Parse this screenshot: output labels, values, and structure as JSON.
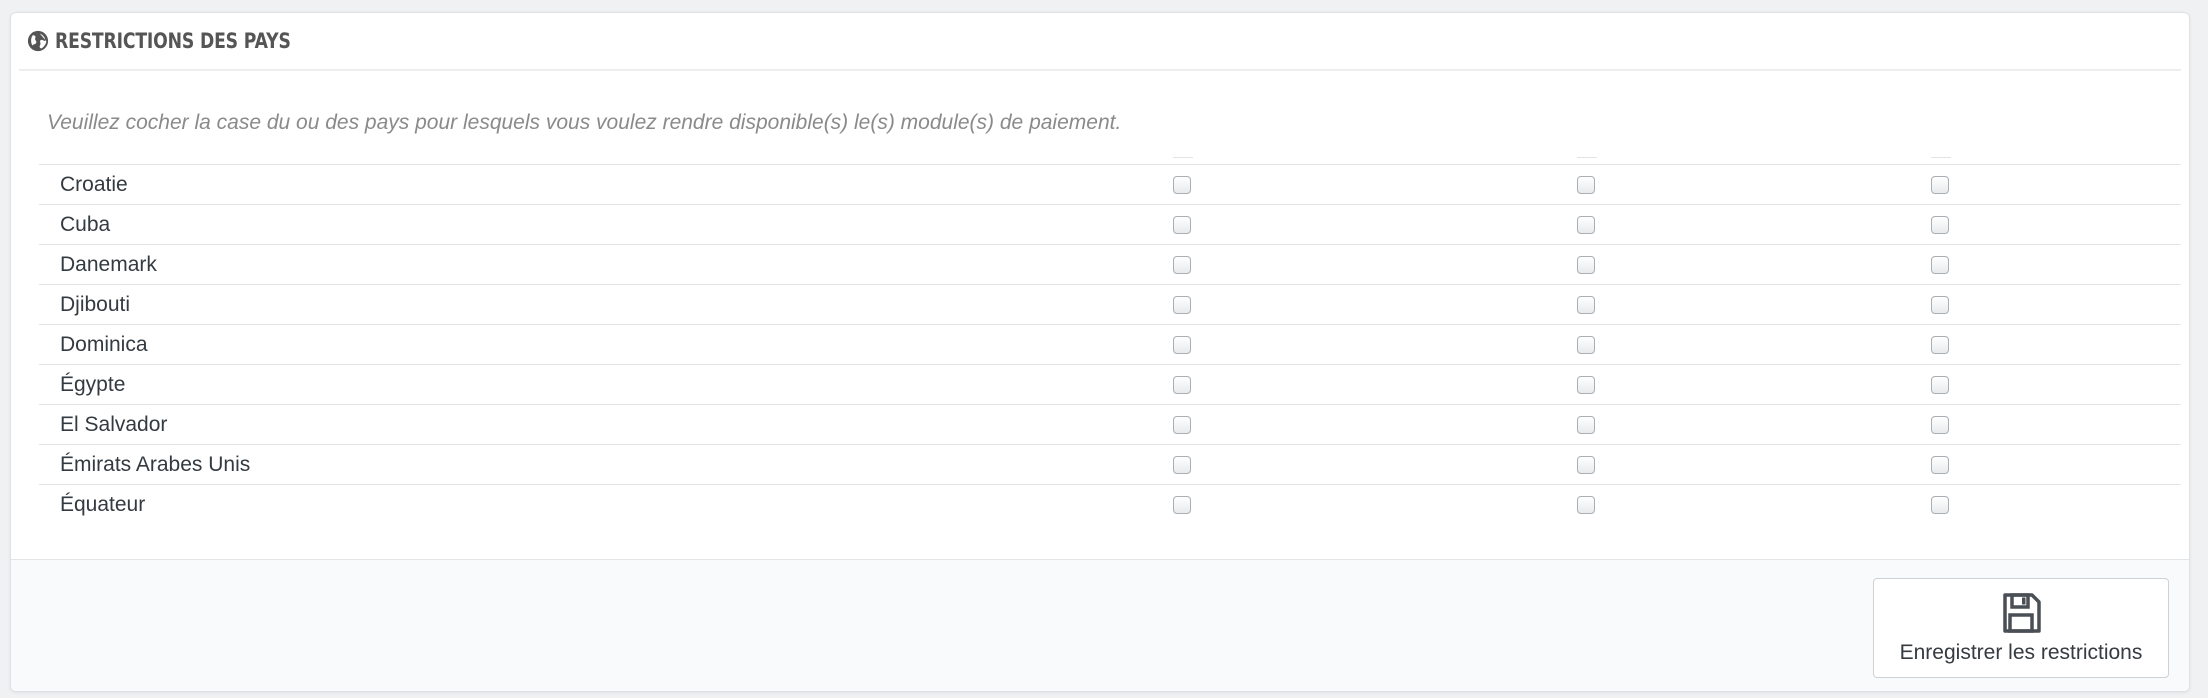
{
  "panel": {
    "title": "RESTRICTIONS DES PAYS",
    "title_icon": "globe-icon",
    "help_text": "Veuillez cocher la case du ou des pays pour lesquels vous voulez rendre disponible(s) le(s) module(s) de paiement."
  },
  "countries": [
    {
      "name": "Croatie",
      "checks": [
        false,
        false,
        false
      ]
    },
    {
      "name": "Cuba",
      "checks": [
        false,
        false,
        false
      ]
    },
    {
      "name": "Danemark",
      "checks": [
        false,
        false,
        false
      ]
    },
    {
      "name": "Djibouti",
      "checks": [
        false,
        false,
        false
      ]
    },
    {
      "name": "Dominica",
      "checks": [
        false,
        false,
        false
      ]
    },
    {
      "name": "Égypte",
      "checks": [
        false,
        false,
        false
      ]
    },
    {
      "name": "El Salvador",
      "checks": [
        false,
        false,
        false
      ]
    },
    {
      "name": "Émirats Arabes Unis",
      "checks": [
        false,
        false,
        false
      ]
    },
    {
      "name": "Équateur",
      "checks": [
        false,
        false,
        false
      ]
    }
  ],
  "footer": {
    "save_label": "Enregistrer les restrictions",
    "save_icon": "floppy-disk-icon"
  },
  "colors": {
    "page_bg": "#eff1f2",
    "footer_bg": "#f8fafc",
    "title": "#555555",
    "help_text": "#8a8a8a"
  }
}
